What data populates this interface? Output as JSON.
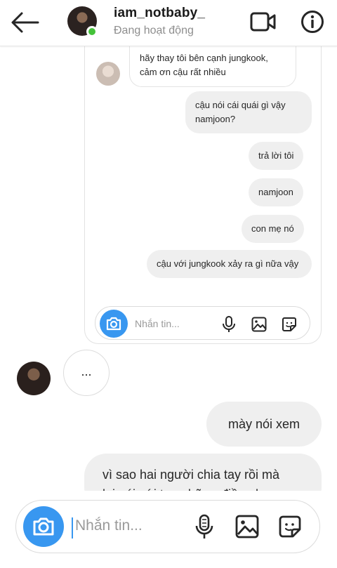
{
  "header": {
    "username": "iam_notbaby_",
    "status": "Đang hoạt động"
  },
  "screenshot": {
    "incoming_message": "hãy thay tôi bên cạnh jungkook, cảm ơn cậu rất nhiều",
    "outgoing_messages": [
      "cậu nói cái quái gì vậy namjoon?",
      "trả lời tôi",
      "namjoon",
      "con mẹ nó",
      "cậu với jungkook xảy ra gì nữa vậy"
    ],
    "composer_placeholder": "Nhắn tin..."
  },
  "thread": {
    "typing_indicator": "...",
    "sent_message": "mày nói xem",
    "partial_message_line1": "vì sao hai người chia tay rồi mà",
    "partial_message_line2": "lại nói với tao những điều như"
  },
  "composer": {
    "placeholder": "Nhắn tin..."
  },
  "colors": {
    "accent": "#3897f0",
    "online": "#44c239",
    "bubble": "#efefef"
  },
  "icons": [
    "back-arrow-icon",
    "video-call-icon",
    "info-icon",
    "camera-icon",
    "microphone-icon",
    "gallery-icon",
    "sticker-icon"
  ]
}
